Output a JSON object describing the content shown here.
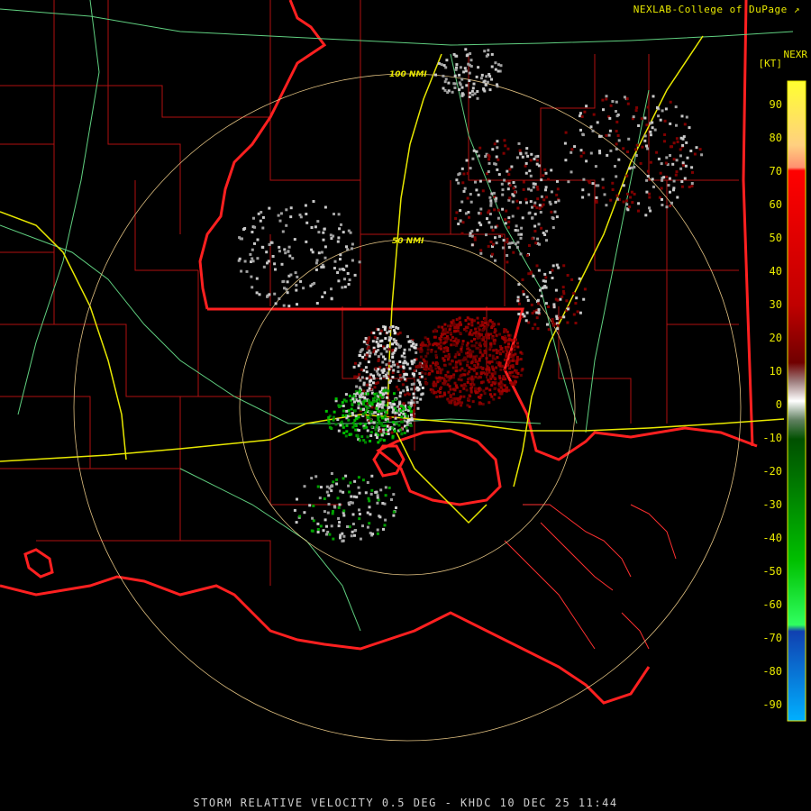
{
  "header": {
    "credit": "NEXLAB-College of DuPage",
    "product": "NEXR",
    "units": "[KT]"
  },
  "footer": {
    "caption": "STORM RELATIVE VELOCITY 0.5 DEG - KHDC 10 DEC 25 11:44"
  },
  "range_rings": [
    "50 NMI",
    "100 NMI"
  ],
  "legend": {
    "ticks": [
      "90",
      "80",
      "70",
      "60",
      "50",
      "40",
      "30",
      "20",
      "10",
      "0",
      "-10",
      "-20",
      "-30",
      "-40",
      "-50",
      "-60",
      "-70",
      "-80",
      "-90"
    ]
  },
  "colors": {
    "border": "#ff2020",
    "county": "#b01010",
    "highway": "#e8e800",
    "road": "#60d080",
    "ring": "#e0c080",
    "text": "#e8e800"
  },
  "icons": {
    "credit": "popout-icon"
  }
}
